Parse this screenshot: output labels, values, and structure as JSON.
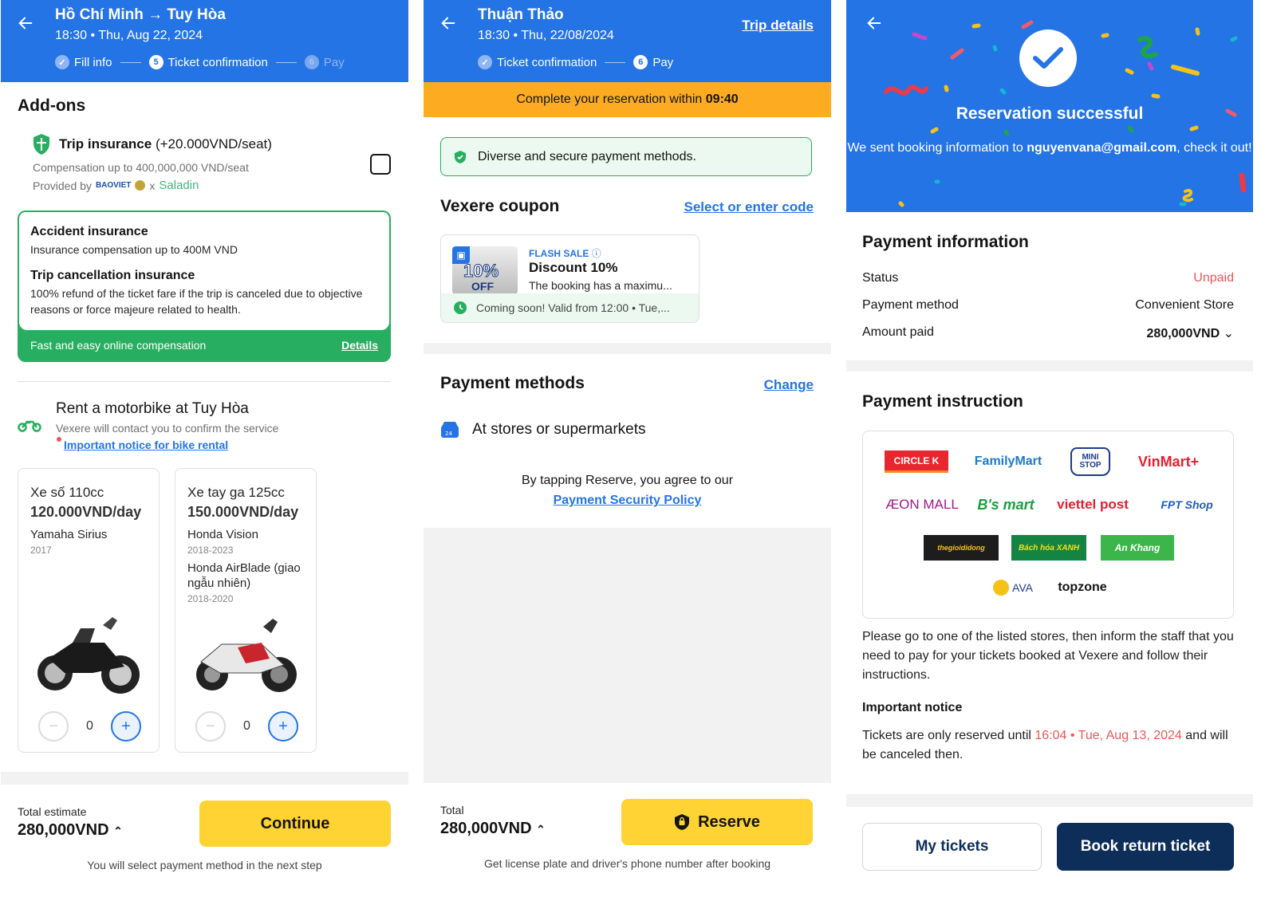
{
  "screen1": {
    "header": {
      "title": "Hồ Chí Minh → Tuy Hòa",
      "subtitle": "18:30 • Thu, Aug 22, 2024",
      "steps": [
        {
          "number": "✓",
          "label": "Fill info",
          "state": "done"
        },
        {
          "number": "5",
          "label": "Ticket confirmation",
          "state": "current"
        },
        {
          "number": "6",
          "label": "Pay",
          "state": "upcoming"
        }
      ]
    },
    "addons_title": "Add-ons",
    "trip_insurance": {
      "title": "Trip insurance",
      "price": "(+20.000VND/seat)",
      "compensation": "Compensation up to 400,000,000 VND/seat",
      "provided_by": "Provided by",
      "provider1": "BAOVIET",
      "separator": "x",
      "provider2": "Saladin",
      "checked": false
    },
    "insurance_card": {
      "items": [
        {
          "title": "Accident insurance",
          "text": "Insurance compensation up to 400M VND"
        },
        {
          "title": "Trip cancellation insurance",
          "text": "100% refund of the ticket fare if the trip is canceled due to objective reasons or force majeure related to health."
        }
      ],
      "footer": "Fast and easy online compensation",
      "details_link": "Details"
    },
    "bike_rental": {
      "title": "Rent a motorbike at Tuy Hòa",
      "subtitle": "Vexere will contact you to confirm the service",
      "notice_link": "Important notice for bike rental",
      "bikes": [
        {
          "name": "Xe số 110cc",
          "price": "120.000VND/day",
          "models": [
            {
              "model": "Yamaha Sirius",
              "years": "2017"
            }
          ],
          "quantity": "0"
        },
        {
          "name": "Xe tay ga 125cc",
          "price": "150.000VND/day",
          "models": [
            {
              "model": "Honda Vision",
              "years": "2018-2023"
            },
            {
              "model": "Honda AirBlade (giao ngẫu nhiên)",
              "years": "2018-2020"
            }
          ],
          "quantity": "0"
        }
      ]
    },
    "footer": {
      "total_label": "Total estimate",
      "total_value": "280,000VND",
      "button": "Continue",
      "note": "You will select payment method in the next step"
    }
  },
  "screen2": {
    "header": {
      "title": "Thuận Thảo",
      "subtitle": "18:30 • Thu, 22/08/2024",
      "trip_details": "Trip details",
      "steps": [
        {
          "number": "✓",
          "label": "Ticket confirmation",
          "state": "done"
        },
        {
          "number": "6",
          "label": "Pay",
          "state": "current"
        }
      ]
    },
    "timer_text": "Complete your reservation within",
    "timer_value": "09:40",
    "secure_text": "Diverse and secure payment methods.",
    "coupon": {
      "title": "Vexere coupon",
      "link": "Select or enter code",
      "image_pct": "10%",
      "image_off": "OFF",
      "tag": "FLASH SALE",
      "name": "Discount 10%",
      "desc": "The booking has a maximu...",
      "validity": "Coming soon! Valid from 12:00 • Tue,..."
    },
    "payment_methods": {
      "title": "Payment methods",
      "change": "Change",
      "method": "At stores or supermarkets",
      "agree_text": "By tapping Reserve, you agree to our",
      "policy_link": "Payment Security Policy"
    },
    "footer": {
      "total_label": "Total",
      "total_value": "280,000VND",
      "button": "Reserve",
      "note": "Get license plate and driver's phone number after booking"
    }
  },
  "screen3": {
    "success_title": "Reservation successful",
    "success_text_before": "We sent booking information to",
    "email": "nguyenvana@gmail.com",
    "success_text_after": ", check it out!",
    "payment_info": {
      "title": "Payment information",
      "rows": [
        {
          "label": "Status",
          "value": "Unpaid"
        },
        {
          "label": "Payment method",
          "value": "Convenient Store"
        },
        {
          "label": "Amount paid",
          "value": "280,000VND"
        }
      ]
    },
    "instruction": {
      "title": "Payment instruction",
      "stores": [
        "CIRCLE K",
        "FamilyMart",
        "MINI STOP",
        "VinMart+",
        "ÆON MALL",
        "B's mart",
        "viettel post",
        "FPT Shop",
        "thegioididong",
        "Bách hóa XANH",
        "An Khang",
        "AVA",
        "topzone"
      ],
      "text": "Please go to one of the listed stores, then inform the staff that you need to pay for your tickets booked at Vexere and follow their instructions.",
      "notice_title": "Important notice",
      "notice_before": "Tickets are only reserved until",
      "notice_time": "16:04 • Tue, Aug 13, 2024",
      "notice_after": "and will be canceled then."
    },
    "buttons": {
      "my_tickets": "My tickets",
      "book_return": "Book return ticket"
    }
  },
  "colors": {
    "primary": "#2474e5",
    "yellow": "#ffd333",
    "orange": "#fdac22",
    "green": "#27ae60",
    "red": "#eb5757",
    "navy": "#0d2e59"
  }
}
